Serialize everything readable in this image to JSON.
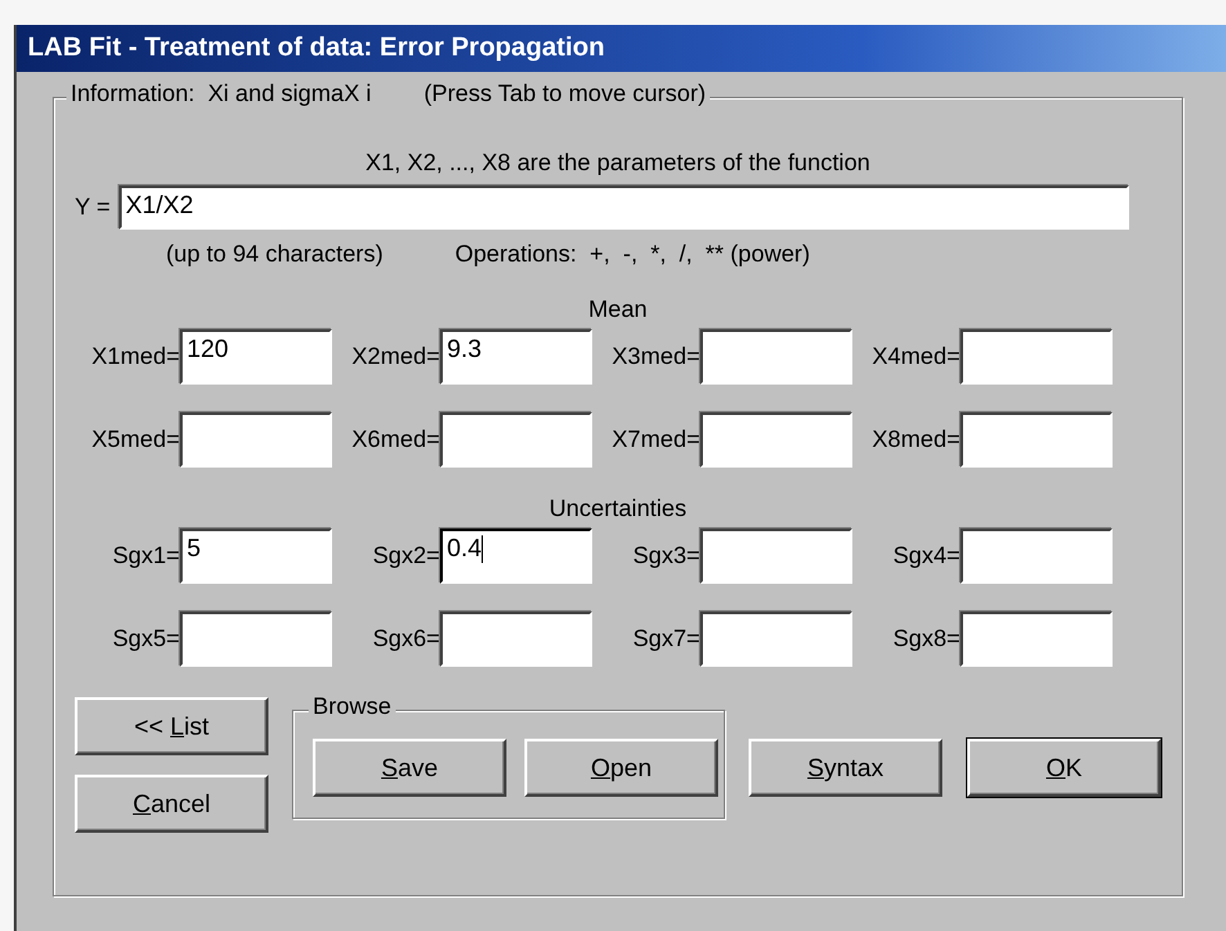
{
  "window": {
    "title": "LAB Fit - Treatment of data: Error Propagation"
  },
  "info_group": {
    "label": "Information:  Xi and sigmaX i",
    "note": "(Press Tab to move cursor)"
  },
  "parameters_note": "X1, X2, ..., X8 are the parameters of the function",
  "function": {
    "label": "Y =",
    "value": "X1/X2"
  },
  "limit_note": "(up to 94 characters)",
  "operations_note": "Operations:  +,  -,  *,  /,  ** (power)",
  "mean": {
    "title": "Mean",
    "fields": [
      {
        "label": "X1med=",
        "value": "120",
        "focused": false
      },
      {
        "label": "X2med=",
        "value": "9.3",
        "focused": false
      },
      {
        "label": "X3med=",
        "focused": false
      },
      {
        "label": "X4med=",
        "focused": false
      },
      {
        "label": "X5med=",
        "focused": false
      },
      {
        "label": "X6med=",
        "focused": false
      },
      {
        "label": "X7med=",
        "focused": false
      },
      {
        "label": "X8med=",
        "focused": false
      }
    ]
  },
  "uncertainties": {
    "title": "Uncertainties",
    "fields": [
      {
        "label": "Sgx1=",
        "value": "5",
        "focused": false
      },
      {
        "label": "Sgx2=",
        "value": "0.4",
        "focused": true
      },
      {
        "label": "Sgx3=",
        "focused": false
      },
      {
        "label": "Sgx4=",
        "focused": false
      },
      {
        "label": "Sgx5=",
        "focused": false
      },
      {
        "label": "Sgx6=",
        "focused": false
      },
      {
        "label": "Sgx7=",
        "focused": false
      },
      {
        "label": "Sgx8=",
        "focused": false
      }
    ]
  },
  "side_buttons": [
    {
      "prefix": "<< ",
      "accel": "L",
      "rest": "ist",
      "default": false
    },
    {
      "accel": "C",
      "rest": "ancel",
      "default": false
    }
  ],
  "browse": {
    "label": "Browse",
    "buttons": [
      {
        "accel": "S",
        "rest": "ave",
        "default": false
      },
      {
        "accel": "O",
        "rest": "pen",
        "default": false
      }
    ]
  },
  "action_buttons": [
    {
      "accel": "S",
      "rest": "yntax",
      "default": false
    },
    {
      "accel": "O",
      "rest": "K",
      "default": true
    }
  ]
}
